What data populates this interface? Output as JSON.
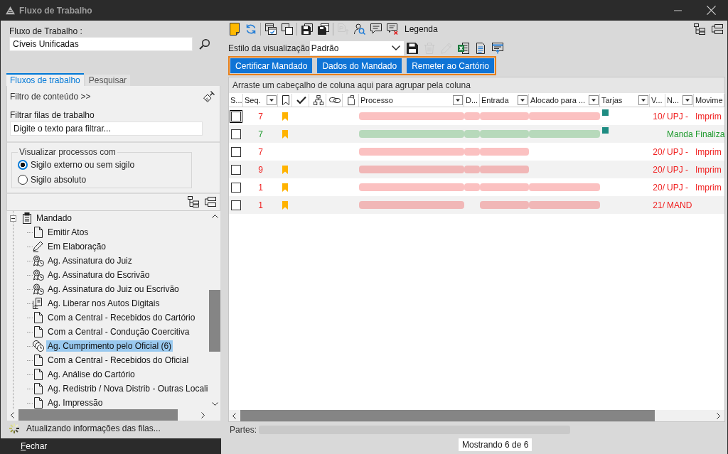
{
  "window": {
    "title": "Fluxo de Trabalho"
  },
  "workflow": {
    "label": "Fluxo de Trabalho :",
    "value": "Cíveis Unificadas"
  },
  "tabs": [
    {
      "label": "Fluxos de trabalho",
      "selected": true
    },
    {
      "label": "Pesquisar",
      "selected": false
    }
  ],
  "filter": {
    "toggle": "Filtro de conteúdo >>",
    "label": "Filtrar filas de trabalho",
    "placeholder": "Digite o texto para filtrar..."
  },
  "visibility": {
    "legend": "Visualizar processos com",
    "options": [
      {
        "label": "Sigilo externo ou sem sigilo",
        "selected": true
      },
      {
        "label": "Sigilo absoluto",
        "selected": false
      }
    ]
  },
  "tree": [
    {
      "label": "Mandado",
      "kind": "clipboard",
      "expanded": true,
      "selected": false,
      "children": [
        {
          "label": "Emitir Atos",
          "kind": "page",
          "selected": false
        },
        {
          "label": "Em Elaboração",
          "kind": "pen",
          "selected": false
        },
        {
          "label": "Ag. Assinatura do Juiz",
          "kind": "seal",
          "selected": false
        },
        {
          "label": "Ag. Assinatura do Escrivão",
          "kind": "seal",
          "selected": false
        },
        {
          "label": "Ag. Assinatura do Juiz ou Escrivão",
          "kind": "seal",
          "selected": false
        },
        {
          "label": "Ag. Liberar nos Autos Digitais",
          "kind": "upload",
          "selected": false
        },
        {
          "label": "Com a Central - Recebidos do Cartório",
          "kind": "page",
          "selected": false
        },
        {
          "label": "Com a Central - Condução Coercitiva",
          "kind": "page",
          "selected": false
        },
        {
          "label": "Ag. Cumprimento pelo Oficial (6)",
          "kind": "clocks",
          "selected": true
        },
        {
          "label": "Com a Central - Recebidos do Oficial",
          "kind": "page",
          "selected": false
        },
        {
          "label": "Ag. Análise do Cartório",
          "kind": "page",
          "selected": false
        },
        {
          "label": "Ag. Redistrib / Nova Distrib - Outras Locali",
          "kind": "page",
          "selected": false
        },
        {
          "label": "Ag. Impressão",
          "kind": "page",
          "selected": false
        }
      ]
    }
  ],
  "status": "Atualizando informações das filas...",
  "close_button": "Fechar",
  "toolbar": {
    "groups": [
      [
        {
          "disabled": false
        },
        {
          "disabled": false
        }
      ],
      [
        {
          "disabled": false
        },
        {
          "disabled": false
        }
      ],
      [
        {
          "disabled": false
        },
        {
          "disabled": false
        }
      ],
      [
        {
          "disabled": true
        },
        {
          "disabled": false
        },
        {
          "disabled": false
        },
        {
          "disabled": false
        }
      ]
    ],
    "legend": "Legenda"
  },
  "view_style": {
    "label": "Estilo da visualização",
    "value": "Padrão",
    "buttons": [
      {
        "disabled": false
      },
      {
        "disabled": true
      },
      {
        "disabled": true
      },
      {
        "disabled": false
      },
      {
        "disabled": false
      },
      {
        "disabled": false
      }
    ]
  },
  "actions": [
    {
      "label": "Certificar Mandado"
    },
    {
      "label": "Dados do Mandado"
    },
    {
      "label": "Remeter ao Cartório"
    }
  ],
  "grid": {
    "group_hint": "Arraste um cabeçalho de coluna aqui para agrupar pela coluna",
    "columns": [
      {
        "kind": "text",
        "label": "S...",
        "filter": false
      },
      {
        "kind": "text",
        "label": "Seq.",
        "filter": true
      },
      {
        "kind": "icon",
        "filter": false
      },
      {
        "kind": "icon",
        "filter": false
      },
      {
        "kind": "icon",
        "filter": false
      },
      {
        "kind": "icon",
        "filter": false
      },
      {
        "kind": "icon",
        "filter": false
      },
      {
        "kind": "text",
        "label": "Processo",
        "filter": true
      },
      {
        "kind": "text",
        "label": "D...",
        "filter": false
      },
      {
        "kind": "text",
        "label": "Entrada",
        "filter": true
      },
      {
        "kind": "text",
        "label": "Alocado para ...",
        "filter": true
      },
      {
        "kind": "text",
        "label": "Tarjas",
        "filter": true
      },
      {
        "kind": "text",
        "label": "V...",
        "filter": false
      },
      {
        "kind": "text",
        "label": "N...",
        "filter": true
      },
      {
        "kind": "text",
        "label": "Movime",
        "filter": false
      }
    ],
    "rows": [
      {
        "selected": false,
        "checked": false,
        "focused": true,
        "color": "#f02020",
        "seq": "7",
        "bookmarked": true,
        "blurred": [
          true,
          true,
          true,
          true
        ],
        "tarja": {
          "color": "#1e8c82"
        },
        "v": "10/",
        "n": "UPJ -",
        "movime": "Imprim"
      },
      {
        "selected": false,
        "checked": false,
        "focused": false,
        "color": "#1f9a2e",
        "seq": "7",
        "bookmarked": true,
        "blurred": [
          true,
          true,
          true,
          true
        ],
        "tarja": {
          "color": "#1e8c82"
        },
        "n": "Manda",
        "movime": "Finaliza"
      },
      {
        "selected": false,
        "checked": false,
        "focused": false,
        "color": "#f02020",
        "seq": "7",
        "bookmarked": false,
        "blurred": [
          true,
          true,
          true,
          false
        ],
        "v": "20/",
        "n": "UPJ -",
        "movime": "Imprim"
      },
      {
        "selected": false,
        "checked": false,
        "focused": false,
        "color": "#f02020",
        "seq": "9",
        "bookmarked": true,
        "blurred": [
          true,
          true,
          true,
          false
        ],
        "v": "20/",
        "n": "UPJ -",
        "movime": "Imprim"
      },
      {
        "selected": false,
        "checked": false,
        "focused": false,
        "color": "#f02020",
        "seq": "1",
        "bookmarked": true,
        "blurred": [
          true,
          true,
          true,
          true
        ],
        "v": "20/",
        "n": "UPJ -",
        "movime": "Imprim"
      },
      {
        "selected": false,
        "checked": false,
        "focused": false,
        "color": "#f02020",
        "seq": "1",
        "bookmarked": true,
        "blurred": [
          true,
          false,
          true,
          true
        ],
        "v": "21/",
        "n": "MAND"
      }
    ]
  },
  "parts_label": "Partes:",
  "record_count": "Mostrando 6 de 6"
}
